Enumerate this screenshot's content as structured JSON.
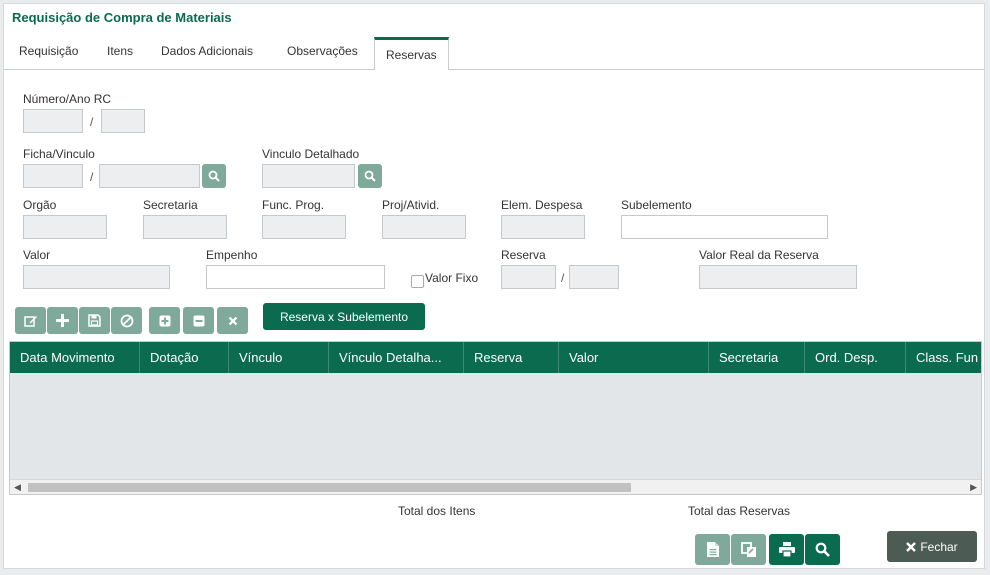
{
  "title": "Requisição de Compra de Materiais",
  "tabs": [
    "Requisição",
    "Itens",
    "Dados Adicionais",
    "Observações",
    "Reservas"
  ],
  "labels": {
    "numero_ano": "Número/Ano RC",
    "ficha_vinculo": "Ficha/Vinculo",
    "vinculo_detalhado": "Vinculo Detalhado",
    "orgao": "Orgão",
    "secretaria": "Secretaria",
    "func_prog": "Func. Prog.",
    "proj_ativid": "Proj/Ativid.",
    "elem_despesa": "Elem. Despesa",
    "subelemento": "Subelemento",
    "valor": "Valor",
    "empenho": "Empenho",
    "valor_fixo": "Valor Fixo",
    "reserva": "Reserva",
    "valor_real": "Valor Real da Reserva"
  },
  "slash": "/",
  "toolbar": {
    "reserva_subelemento": "Reserva x Subelemento"
  },
  "grid": {
    "columns": [
      "Data Movimento",
      "Dotação",
      "Vínculo",
      "Vínculo Detalha...",
      "Reserva",
      "Valor",
      "Secretaria",
      "Ord. Desp.",
      "Class. Fun"
    ]
  },
  "totals": {
    "itens": "Total dos Itens",
    "reservas": "Total das Reservas"
  },
  "footer": {
    "fechar": "Fechar"
  },
  "colors": {
    "primary": "#0b6b4e",
    "muted_button": "#7fa99b",
    "close_button": "#4d5b55"
  }
}
